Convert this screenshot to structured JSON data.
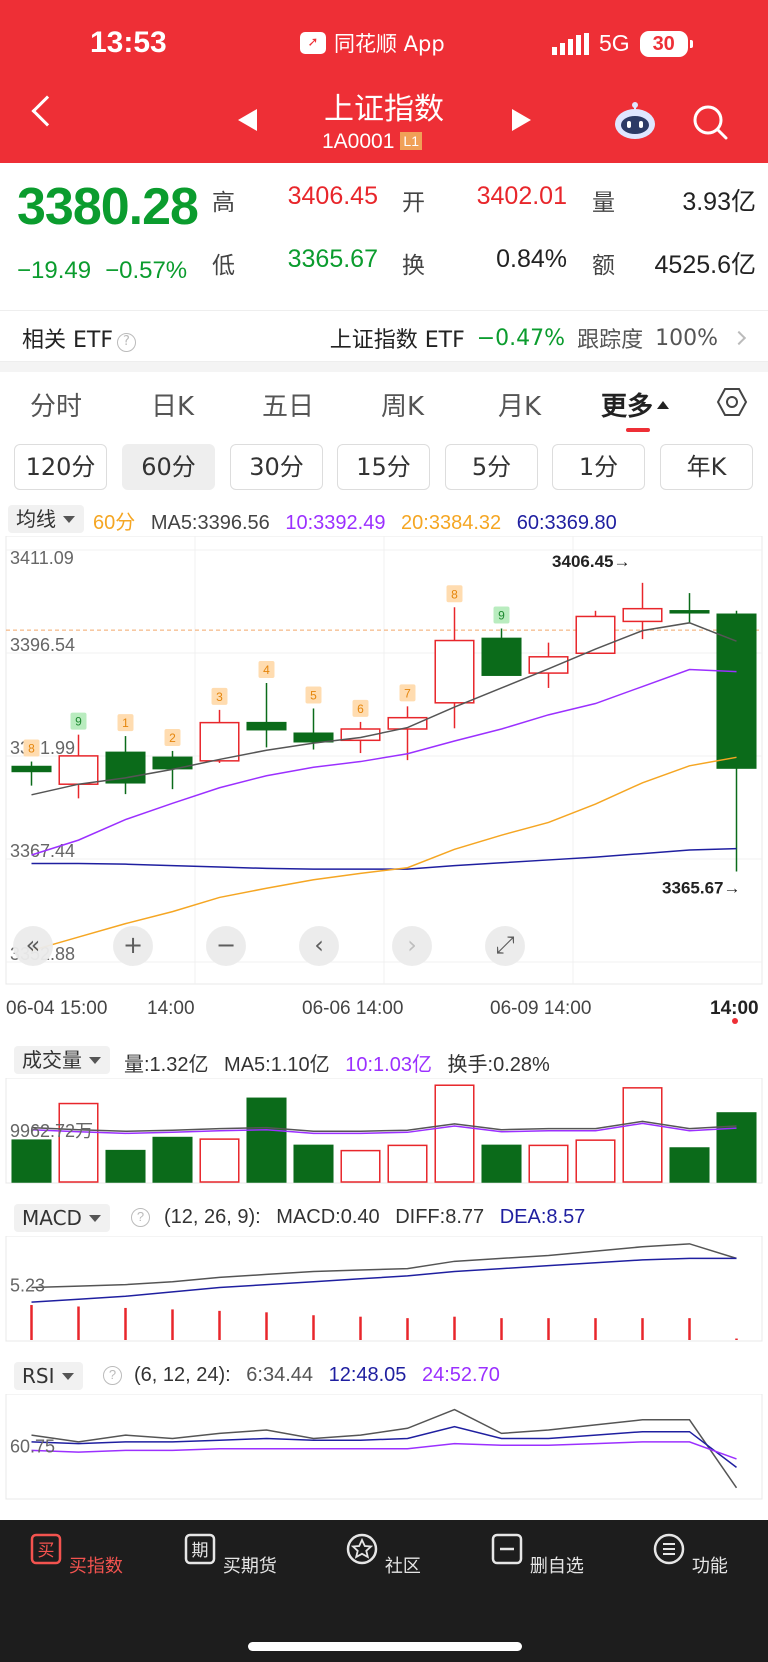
{
  "status": {
    "time": "13:53",
    "app": "同花顺 App",
    "network": "5G",
    "battery": "30"
  },
  "nav": {
    "title": "上证指数",
    "code": "1A0001",
    "level": "L1"
  },
  "quote": {
    "price": "3380.28",
    "change": "−19.49",
    "change_pct": "−0.57%",
    "high_label": "高",
    "high": "3406.45",
    "low_label": "低",
    "low": "3365.67",
    "open_label": "开",
    "open": "3402.01",
    "turnover_label": "换",
    "turnover": "0.84%",
    "volume_label": "量",
    "volume": "3.93亿",
    "amount_label": "额",
    "amount": "4525.6亿"
  },
  "etf": {
    "label": "相关 ETF",
    "name": "上证指数 ETF",
    "change": "−0.47%",
    "tracking_label": "跟踪度",
    "tracking": "100%"
  },
  "tabs": [
    "分时",
    "日K",
    "五日",
    "周K",
    "月K",
    "更多"
  ],
  "active_tab": "更多",
  "periods": [
    "120分",
    "60分",
    "30分",
    "15分",
    "5分",
    "1分",
    "年K"
  ],
  "active_period": "60分",
  "ma": {
    "dropdown": "均线",
    "period": "60分",
    "ma5": "MA5:3396.56",
    "ma10": "10:3392.49",
    "ma20": "20:3384.32",
    "ma60": "60:3369.80"
  },
  "colors": {
    "up": "#e8262b",
    "down": "#0b6b1a",
    "ma5": "#555555",
    "ma10": "#9b30ff",
    "ma20": "#f5a623",
    "ma60": "#1f1fa0",
    "brand": "#ee2f36"
  },
  "x_axis": [
    "06-04 15:00",
    "14:00",
    "06-06 14:00",
    "06-09 14:00",
    "14:00"
  ],
  "volume_panel": {
    "dropdown": "成交量",
    "vol": "量:1.32亿",
    "ma5": "MA5:1.10亿",
    "ma10": "10:1.03亿",
    "turnover": "换手:0.28%",
    "axis_label": "9962.72万"
  },
  "macd_panel": {
    "dropdown": "MACD",
    "params": "(12, 26, 9):",
    "macd": "MACD:0.40",
    "diff": "DIFF:8.77",
    "dea": "DEA:8.57",
    "axis_label": "5.23"
  },
  "rsi_panel": {
    "dropdown": "RSI",
    "params": "(6, 12, 24):",
    "rsi6": "6:34.44",
    "rsi12": "12:48.05",
    "rsi24": "24:52.70",
    "axis_label": "60.75"
  },
  "bottom_nav": [
    {
      "label": "买指数",
      "icon": "buy-icon",
      "glyph": "买"
    },
    {
      "label": "买期货",
      "icon": "futures-icon",
      "glyph": "期"
    },
    {
      "label": "社区",
      "icon": "community-icon",
      "glyph": "☆"
    },
    {
      "label": "删自选",
      "icon": "remove-watchlist-icon",
      "glyph": "−"
    },
    {
      "label": "功能",
      "icon": "menu-icon",
      "glyph": "≡"
    }
  ],
  "chart_data": {
    "type": "candlestick",
    "y_ticks": [
      "3411.09",
      "3396.54",
      "3381.99",
      "3367.44",
      "3352.88"
    ],
    "ylim": [
      3352.88,
      3411.09
    ],
    "high_marker": "3406.45→",
    "low_marker": "3365.67→",
    "candles": [
      {
        "open": 3380.5,
        "close": 3379.8,
        "high": 3381.2,
        "low": 3377.8,
        "seq": "8"
      },
      {
        "open": 3378.0,
        "close": 3382.0,
        "high": 3385.0,
        "low": 3376.0,
        "seq": "9"
      },
      {
        "open": 3382.5,
        "close": 3378.2,
        "high": 3384.8,
        "low": 3376.6,
        "seq": "1"
      },
      {
        "open": 3381.8,
        "close": 3380.2,
        "high": 3382.7,
        "low": 3377.3,
        "seq": "2"
      },
      {
        "open": 3381.3,
        "close": 3386.7,
        "high": 3388.5,
        "low": 3381.0,
        "seq": "3"
      },
      {
        "open": 3386.7,
        "close": 3385.7,
        "high": 3392.3,
        "low": 3383.2,
        "seq": "4"
      },
      {
        "open": 3385.2,
        "close": 3384.0,
        "high": 3388.7,
        "low": 3382.9,
        "seq": "5"
      },
      {
        "open": 3384.2,
        "close": 3385.8,
        "high": 3386.8,
        "low": 3382.4,
        "seq": "6"
      },
      {
        "open": 3385.8,
        "close": 3387.4,
        "high": 3389.0,
        "low": 3381.4,
        "seq": "7"
      },
      {
        "open": 3389.5,
        "close": 3398.3,
        "high": 3403.0,
        "low": 3385.9,
        "seq": "8"
      },
      {
        "open": 3398.6,
        "close": 3393.4,
        "high": 3400.0,
        "low": 3393.4,
        "seq": "9"
      },
      {
        "open": 3393.7,
        "close": 3396.0,
        "high": 3398.0,
        "low": 3391.6,
        "seq": ""
      },
      {
        "open": 3396.5,
        "close": 3401.7,
        "high": 3402.5,
        "low": 3396.5,
        "seq": ""
      },
      {
        "open": 3401.0,
        "close": 3402.8,
        "high": 3406.45,
        "low": 3398.5,
        "seq": ""
      },
      {
        "open": 3402.5,
        "close": 3402.3,
        "high": 3405.0,
        "low": 3400.8,
        "seq": ""
      },
      {
        "open": 3402.01,
        "close": 3380.28,
        "high": 3402.5,
        "low": 3365.67,
        "seq": ""
      }
    ],
    "ma5": [
      3376.5,
      3378.0,
      3378.9,
      3380.1,
      3381.5,
      3382.8,
      3383.8,
      3384.6,
      3386.0,
      3388.9,
      3391.6,
      3394.3,
      3397.1,
      3399.7,
      3400.8,
      3398.2
    ],
    "ma10": [
      3368.0,
      3370.1,
      3373.0,
      3375.3,
      3377.5,
      3379.2,
      3380.4,
      3381.2,
      3382.3,
      3384.1,
      3385.8,
      3387.8,
      3389.4,
      3391.8,
      3394.2,
      3393.9
    ],
    "ma20": [
      3354.5,
      3356.4,
      3358.3,
      3360.0,
      3362.0,
      3363.3,
      3364.5,
      3365.4,
      3366.2,
      3368.8,
      3370.8,
      3372.6,
      3375.2,
      3378.2,
      3380.6,
      3381.8
    ],
    "ma60": [
      3366.8,
      3366.8,
      3366.7,
      3366.5,
      3366.3,
      3366.1,
      3366.0,
      3366.0,
      3366.0,
      3366.5,
      3366.9,
      3367.3,
      3367.7,
      3368.2,
      3368.7,
      3368.9
    ],
    "volume": [
      0.8,
      1.5,
      0.6,
      0.85,
      0.82,
      1.6,
      0.7,
      0.6,
      0.7,
      1.85,
      0.7,
      0.7,
      0.8,
      1.8,
      0.65,
      1.32
    ],
    "volume_ma": [
      1.0,
      0.96,
      0.93,
      0.95,
      0.98,
      1.0,
      0.93,
      0.93,
      0.95,
      1.07,
      0.96,
      0.98,
      0.98,
      1.12,
      0.98,
      1.03
    ],
    "macd_diff": [
      18.0,
      18.5,
      19.0,
      20.0,
      21.5,
      22.5,
      23.5,
      24.0,
      24.5,
      27.0,
      28.0,
      29.0,
      30.5,
      32.0,
      33.0,
      28.0
    ],
    "macd_dea": [
      13.0,
      14.0,
      15.0,
      16.5,
      18.0,
      19.0,
      20.0,
      21.0,
      22.0,
      23.5,
      24.5,
      25.5,
      26.5,
      27.5,
      28.0,
      28.0
    ],
    "macd_hist": [
      12.0,
      11.5,
      11.0,
      10.5,
      10.0,
      9.5,
      8.5,
      8.0,
      7.5,
      8.0,
      7.5,
      7.5,
      7.5,
      7.5,
      7.5,
      0.5
    ],
    "rsi6": [
      67,
      63,
      67,
      65,
      68,
      70,
      65,
      67,
      71,
      82,
      68,
      70,
      73,
      76,
      76,
      36
    ],
    "rsi12": [
      63,
      62,
      63,
      63,
      64,
      65,
      64,
      64,
      65,
      72,
      65,
      65,
      67,
      69,
      69,
      48
    ],
    "rsi24": [
      58,
      57,
      58,
      58,
      59,
      59,
      59,
      59,
      59,
      62,
      61,
      61,
      62,
      63,
      63,
      53
    ],
    "rsi_ylim": [
      30,
      90
    ]
  }
}
